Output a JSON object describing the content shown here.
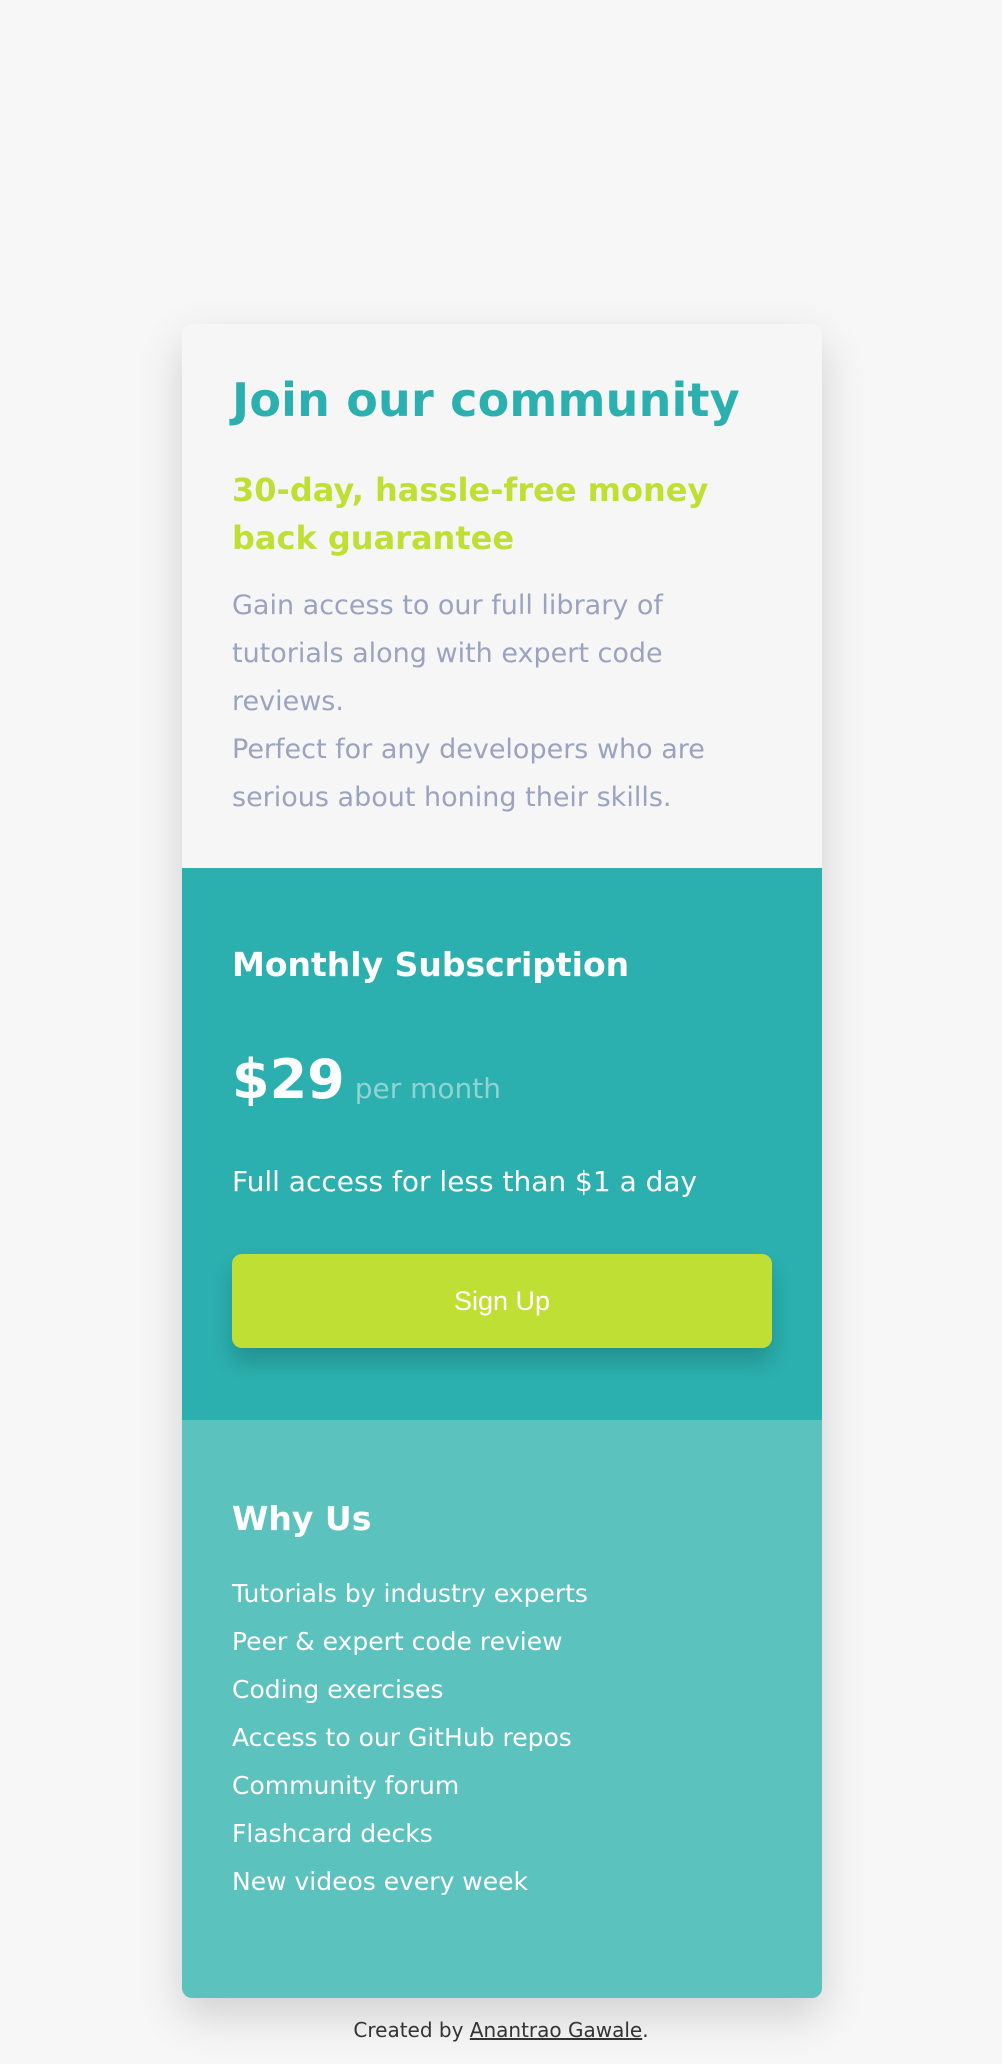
{
  "header": {
    "title": "Join our community",
    "subtitle": "30-day, hassle-free money back guarantee",
    "description_lines": [
      "Gain access to our full library of tutorials along with expert code reviews.",
      "Perfect for any developers who are serious about honing their skills."
    ]
  },
  "pricing": {
    "title": "Monthly Subscription",
    "price": "$29",
    "period": "per month",
    "access_text": "Full access for less than $1 a day",
    "signup_label": "Sign Up"
  },
  "why": {
    "title": "Why Us",
    "items": [
      "Tutorials by industry experts",
      "Peer & expert code review",
      "Coding exercises",
      "Access to our GitHub repos",
      "Community forum",
      "Flashcard decks",
      "New videos every week"
    ]
  },
  "footer": {
    "prefix": "Created by ",
    "author": "Anantrao Gawale",
    "suffix": "."
  },
  "colors": {
    "background": "#f7f7f7",
    "teal": "#2bb0af",
    "teal_light": "#5bc2be",
    "lime": "#c0df34",
    "muted_text": "#9aa3bf"
  }
}
